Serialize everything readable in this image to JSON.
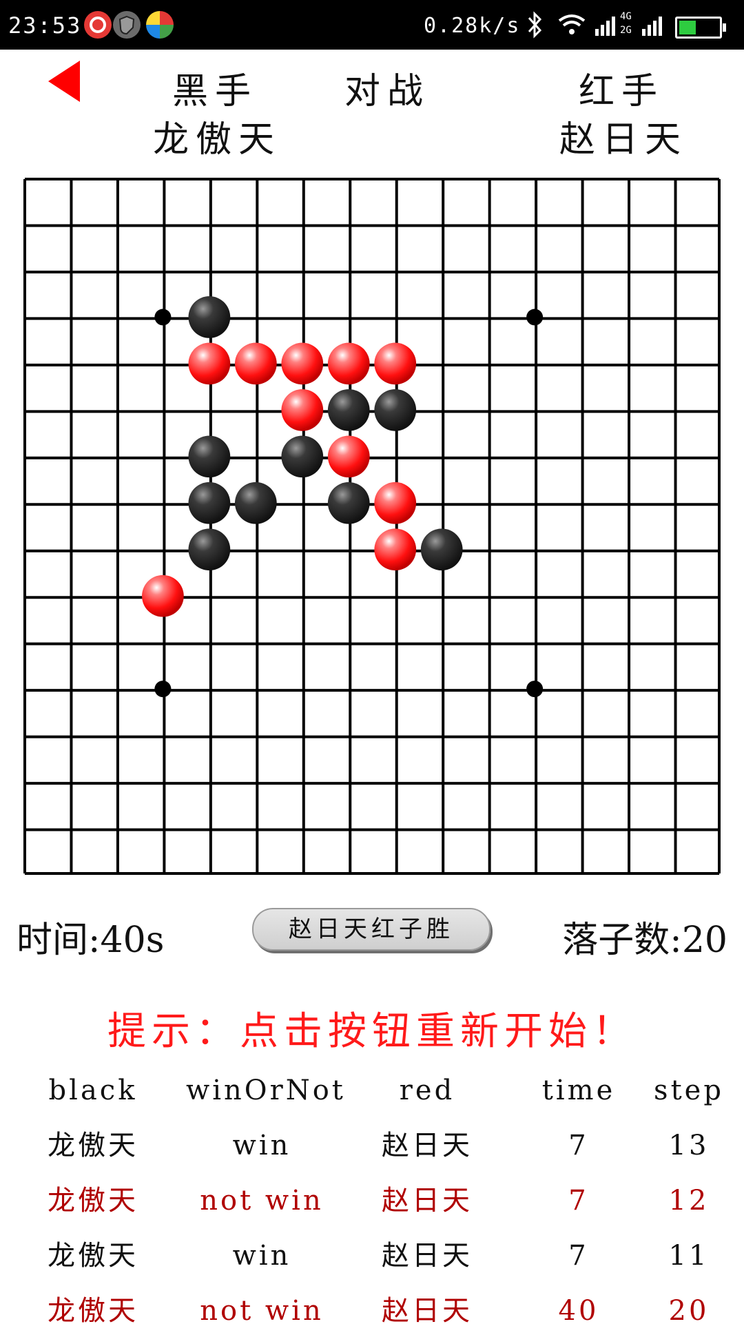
{
  "status_bar": {
    "time": "23:53",
    "speed": "0.28k/s",
    "icons": [
      "netease-music-icon",
      "shield-icon",
      "color-wheel-icon",
      "bluetooth-icon",
      "wifi-icon",
      "signal-icon",
      "battery-icon"
    ],
    "network_labels": [
      "4G",
      "2G"
    ]
  },
  "header": {
    "black_label": "黑手",
    "vs_label": "对战",
    "red_label": "红手",
    "black_player": "龙傲天",
    "red_player": "赵日天"
  },
  "board": {
    "size": 15,
    "grid_color": "#000000",
    "star_points": [
      [
        3,
        3
      ],
      [
        11,
        3
      ],
      [
        3,
        11
      ],
      [
        11,
        11
      ]
    ],
    "black_stones": [
      [
        4,
        3
      ],
      [
        7,
        5
      ],
      [
        8,
        5
      ],
      [
        4,
        6
      ],
      [
        6,
        6
      ],
      [
        4,
        7
      ],
      [
        5,
        7
      ],
      [
        7,
        7
      ],
      [
        4,
        8
      ],
      [
        9,
        8
      ]
    ],
    "red_stones": [
      [
        4,
        4
      ],
      [
        5,
        4
      ],
      [
        6,
        4
      ],
      [
        7,
        4
      ],
      [
        8,
        4
      ],
      [
        6,
        5
      ],
      [
        7,
        6
      ],
      [
        8,
        7
      ],
      [
        8,
        8
      ],
      [
        3,
        9
      ]
    ],
    "colors": {
      "black_stone": "#2a2a2a",
      "red_stone": "#ff2020"
    }
  },
  "info": {
    "time_text": "时间:40s",
    "result_button": "赵日天红子胜",
    "steps_text": "落子数:20"
  },
  "hint": "提示：点击按钮重新开始！",
  "records": {
    "headers": [
      "black",
      "winOrNot",
      "red",
      "time",
      "step"
    ],
    "rows": [
      {
        "black": "龙傲天",
        "result": "win",
        "red": "赵日天",
        "time": "7",
        "step": "13",
        "style": "black"
      },
      {
        "black": "龙傲天",
        "result": "not win",
        "red": "赵日天",
        "time": "7",
        "step": "12",
        "style": "red"
      },
      {
        "black": "龙傲天",
        "result": "win",
        "red": "赵日天",
        "time": "7",
        "step": "11",
        "style": "black"
      },
      {
        "black": "龙傲天",
        "result": "not win",
        "red": "赵日天",
        "time": "40",
        "step": "20",
        "style": "red"
      }
    ]
  }
}
